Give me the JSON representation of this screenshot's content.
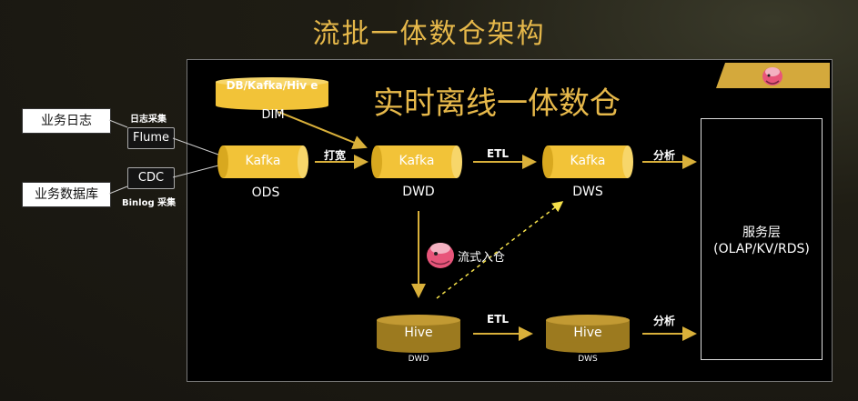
{
  "title": "流批一体数仓架构",
  "subtitle": "实时离线一体数仓",
  "sources": {
    "logs": "业务日志",
    "db": "业务数据库",
    "flume": "Flume",
    "cdc": "CDC",
    "flume_note": "日志采集",
    "cdc_note": "Binlog 采集"
  },
  "dim": {
    "cylinder": "DB/Kafka/Hiv e",
    "label": "DIM"
  },
  "realtime": {
    "ods": {
      "cylinder": "Kafka",
      "label": "ODS"
    },
    "dwd": {
      "cylinder": "Kafka",
      "label": "DWD"
    },
    "dws": {
      "cylinder": "Kafka",
      "label": "DWS"
    }
  },
  "batch": {
    "dwd": {
      "cylinder": "Hive",
      "label": "DWD"
    },
    "dws": {
      "cylinder": "Hive",
      "label": "DWS"
    }
  },
  "edges": {
    "widen": "打宽",
    "etl_top": "ETL",
    "analyze_top": "分析",
    "stream_ingest": "流式入仓",
    "etl_bottom": "ETL",
    "analyze_bottom": "分析"
  },
  "service": {
    "line1": "服务层",
    "line2": "(OLAP/KV/RDS)"
  },
  "colors": {
    "gold": "#e6b84a",
    "kafka_fill": "#f2c338",
    "hive_fill": "#9c7a1f",
    "arrow": "#c9a227"
  }
}
